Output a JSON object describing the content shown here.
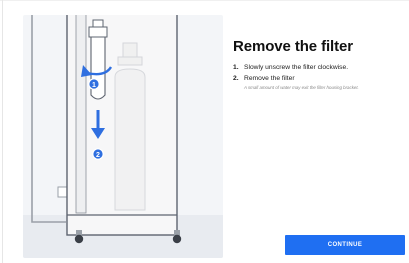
{
  "page": {
    "title": "Remove the filter",
    "steps": [
      {
        "num": "1.",
        "text": "Slowly unscrew the filter clockwise."
      },
      {
        "num": "2.",
        "text": "Remove the filter"
      }
    ],
    "note": "A small amount of water may exit the filter housing bracket.",
    "continue_label": "CONTINUE"
  },
  "illustration": {
    "markers": [
      "1",
      "2"
    ],
    "accent_color": "#2f6fe0",
    "button_color": "#1f6ff2"
  }
}
